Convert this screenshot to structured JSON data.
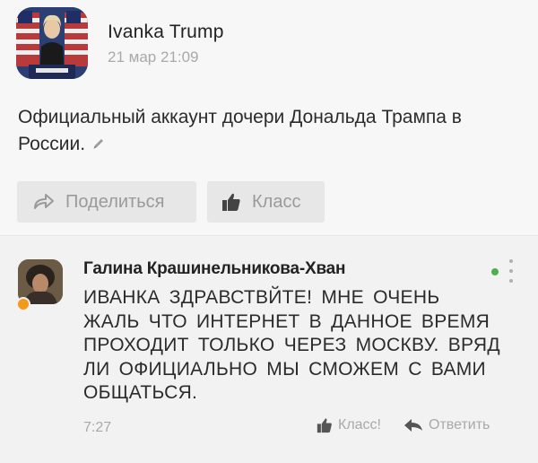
{
  "post": {
    "author": "Ivanka Trump",
    "time": "21 мар 21:09",
    "text": "Официальный аккаунт дочери Дональда Трампа в России.",
    "share_label": "Поделиться",
    "like_label": "Класс"
  },
  "comment": {
    "author": "Галина Крашинельникова-Хван",
    "text": "ИВАНКА  ЗДРАВСТВЙТЕ! МНЕ ОЧЕНЬ ЖАЛЬ ЧТО ИНТЕРНЕТ В ДАННОЕ ВРЕМЯ ПРОХОДИТ ТОЛЬКО ЧЕРЕЗ МОСКВУ. ВРЯД ЛИ ОФИЦИАЛЬНО МЫ СМОЖЕМ С ВАМИ ОБЩАТЬСЯ.",
    "time": "7:27",
    "like_label": "Класс!",
    "reply_label": "Ответить"
  },
  "colors": {
    "online": "#4caf50",
    "presence": "#f39a1c",
    "muted": "#a9a9a9"
  },
  "icons": {
    "share": "share-arrow-icon",
    "like": "thumbs-up-icon",
    "reply": "reply-arrow-icon",
    "edit": "pencil-icon",
    "more": "more-vertical-icon"
  }
}
